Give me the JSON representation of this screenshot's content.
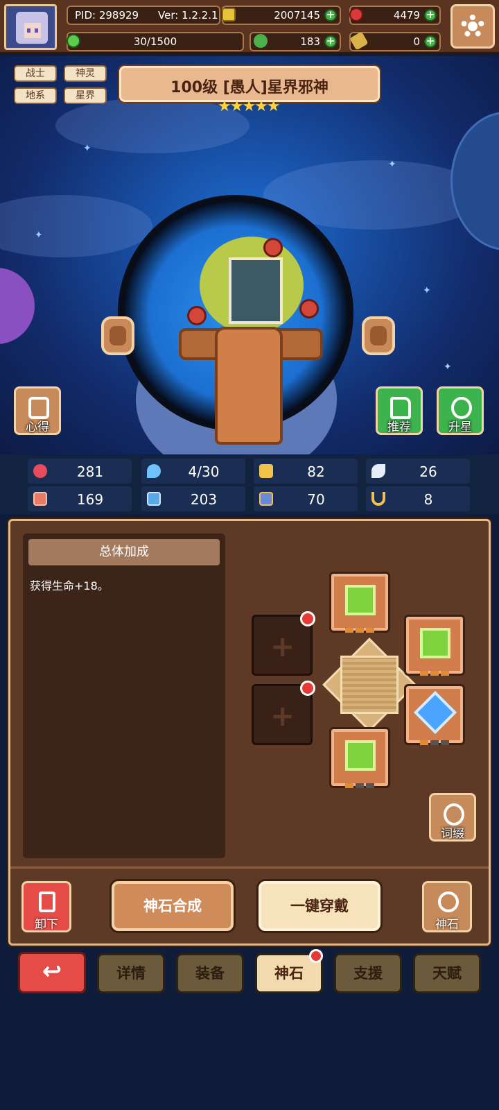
{
  "header": {
    "pid": "PID: 298929",
    "version": "Ver: 1.2.2.1",
    "gold": "2007145",
    "ruby": "4479",
    "energy": "30/1500",
    "clover": "183",
    "key": "0"
  },
  "hero": {
    "tags": [
      "战士",
      "神灵",
      "地系",
      "星界"
    ],
    "title": "100级  [愚人]星界邪神",
    "stars": "★★★★★",
    "star_count": 5,
    "buttons": {
      "insight": "心得",
      "recommend": "推荐",
      "star_up": "升星"
    }
  },
  "stats": [
    {
      "icon": "heart-icon",
      "value": "281"
    },
    {
      "icon": "water-drop-icon",
      "value": "4/30"
    },
    {
      "icon": "shield-icon",
      "value": "82"
    },
    {
      "icon": "wing-icon",
      "value": "26"
    },
    {
      "icon": "fist-icon",
      "value": "169"
    },
    {
      "icon": "book-icon",
      "value": "203"
    },
    {
      "icon": "boot-icon",
      "value": "70"
    },
    {
      "icon": "horseshoe-icon",
      "value": "8"
    }
  ],
  "panel": {
    "header": "总体加成",
    "description": "获得生命+18。",
    "affix_label": "词缀",
    "unequip_label": "卸下",
    "synth_label": "神石合成",
    "equip_all_label": "一键穿戴",
    "godstone_label": "神石"
  },
  "tabs": {
    "back": "↩",
    "items": [
      "详情",
      "装备",
      "神石",
      "支援",
      "天赋"
    ],
    "active": "神石"
  },
  "colors": {
    "accent_red": "#e53a35",
    "panel_brown": "#5e3a26",
    "gold_border": "#e2b98f",
    "green_gem": "#7fd23c",
    "blue_gem": "#4aa3ff"
  }
}
